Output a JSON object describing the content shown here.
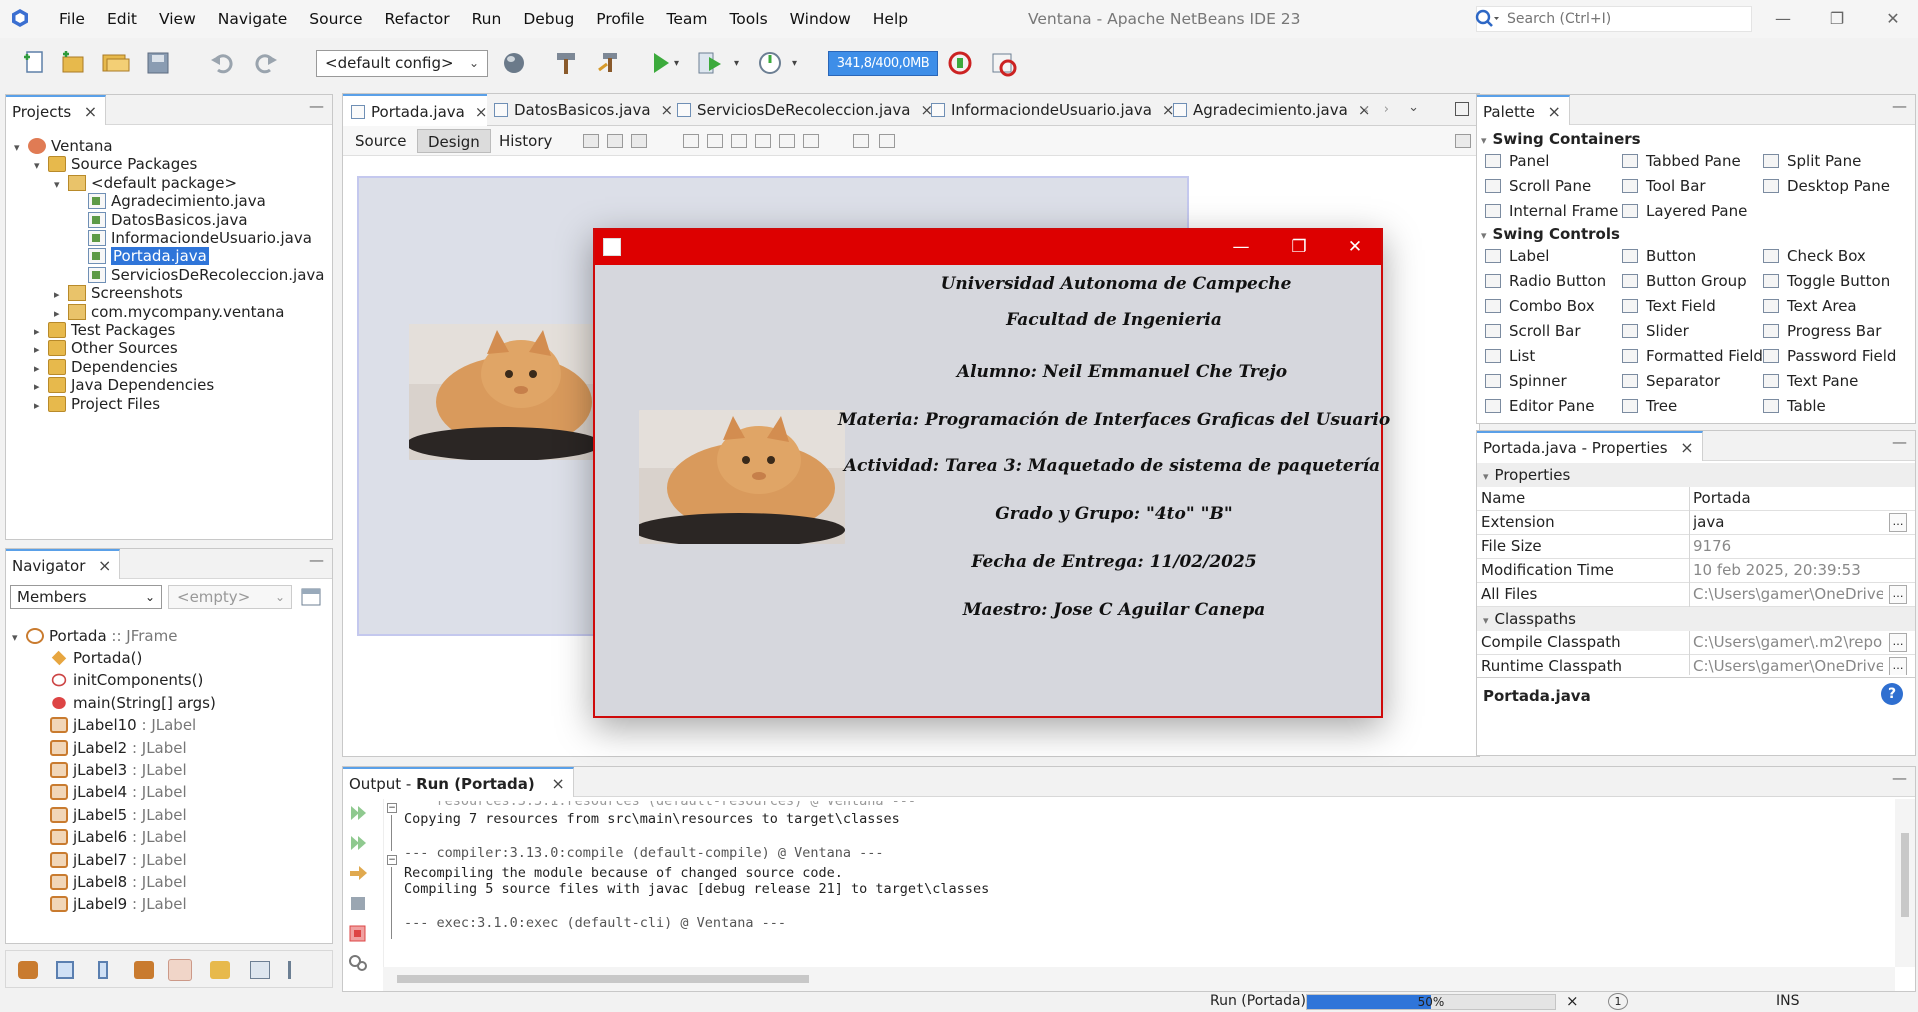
{
  "window": {
    "title": "Ventana - Apache NetBeans IDE 23",
    "search_placeholder": "Search (Ctrl+I)",
    "minimize": "—",
    "maximize": "❐",
    "close": "✕"
  },
  "menu": [
    "File",
    "Edit",
    "View",
    "Navigate",
    "Source",
    "Refactor",
    "Run",
    "Debug",
    "Profile",
    "Team",
    "Tools",
    "Window",
    "Help"
  ],
  "toolbar": {
    "config": "<default config>",
    "memory": "341,8/400,0MB",
    "memory_fraction": 0.854
  },
  "projects": {
    "tab": "Projects",
    "tree": [
      {
        "label": "Ventana",
        "icon": "project-icon",
        "depth": 0,
        "arrow": "▾"
      },
      {
        "label": "Source Packages",
        "icon": "folder-icon",
        "depth": 1,
        "arrow": "▾"
      },
      {
        "label": "<default package>",
        "icon": "package-icon",
        "depth": 2,
        "arrow": "▾"
      },
      {
        "label": "Agradecimiento.java",
        "icon": "java-file-icon",
        "depth": 3,
        "arrow": ""
      },
      {
        "label": "DatosBasicos.java",
        "icon": "java-file-icon",
        "depth": 3,
        "arrow": ""
      },
      {
        "label": "InformaciondeUsuario.java",
        "icon": "java-file-icon",
        "depth": 3,
        "arrow": ""
      },
      {
        "label": "Portada.java",
        "icon": "java-file-icon",
        "depth": 3,
        "arrow": "",
        "selected": true
      },
      {
        "label": "ServiciosDeRecoleccion.java",
        "icon": "java-file-icon",
        "depth": 3,
        "arrow": ""
      },
      {
        "label": "Screenshots",
        "icon": "package-icon",
        "depth": 2,
        "arrow": "▸"
      },
      {
        "label": "com.mycompany.ventana",
        "icon": "package-icon",
        "depth": 2,
        "arrow": "▸"
      },
      {
        "label": "Test Packages",
        "icon": "folder-icon",
        "depth": 1,
        "arrow": "▸"
      },
      {
        "label": "Other Sources",
        "icon": "folder-icon",
        "depth": 1,
        "arrow": "▸"
      },
      {
        "label": "Dependencies",
        "icon": "folder-icon",
        "depth": 1,
        "arrow": "▸"
      },
      {
        "label": "Java Dependencies",
        "icon": "folder-icon",
        "depth": 1,
        "arrow": "▸"
      },
      {
        "label": "Project Files",
        "icon": "folder-icon",
        "depth": 1,
        "arrow": "▸"
      }
    ]
  },
  "navigator": {
    "tab": "Navigator",
    "filter": "Members",
    "filter2": "<empty>",
    "root": {
      "name": "Portada",
      "type": " :: JFrame"
    },
    "members": [
      {
        "name": "Portada()",
        "type": "",
        "icon": "constructor-icon"
      },
      {
        "name": "initComponents()",
        "type": "",
        "icon": "method-icon"
      },
      {
        "name": "main(String[] args)",
        "type": "",
        "icon": "static-method-icon"
      },
      {
        "name": "jLabel10",
        "type": " : JLabel",
        "icon": "field-icon"
      },
      {
        "name": "jLabel2",
        "type": " : JLabel",
        "icon": "field-icon"
      },
      {
        "name": "jLabel3",
        "type": " : JLabel",
        "icon": "field-icon"
      },
      {
        "name": "jLabel4",
        "type": " : JLabel",
        "icon": "field-icon"
      },
      {
        "name": "jLabel5",
        "type": " : JLabel",
        "icon": "field-icon"
      },
      {
        "name": "jLabel6",
        "type": " : JLabel",
        "icon": "field-icon"
      },
      {
        "name": "jLabel7",
        "type": " : JLabel",
        "icon": "field-icon"
      },
      {
        "name": "jLabel8",
        "type": " : JLabel",
        "icon": "field-icon"
      },
      {
        "name": "jLabel9",
        "type": " : JLabel",
        "icon": "field-icon"
      }
    ]
  },
  "editor": {
    "tabs": [
      "Portada.java",
      "DatosBasicos.java",
      "ServiciosDeRecoleccion.java",
      "InformaciondeUsuario.java",
      "Agradecimiento.java"
    ],
    "active_tab": 0,
    "views": {
      "source": "Source",
      "design": "Design",
      "history": "History"
    }
  },
  "run_window": {
    "lines": [
      "Universidad Autonoma de Campeche",
      "Facultad de Ingenieria",
      "Alumno: Neil Emmanuel Che Trejo",
      "Materia: Programación de Interfaces Graficas del Usuario",
      "Actividad: Tarea 3: Maquetado de sistema de paquetería",
      "Grado y Grupo: \"4to\" \"B\"",
      "Fecha de Entrega: 11/02/2025",
      "Maestro: Jose C Aguilar Canepa"
    ]
  },
  "palette": {
    "tab": "Palette",
    "containers_title": "Swing Containers",
    "containers": [
      "Panel",
      "Tabbed Pane",
      "Split Pane",
      "Scroll Pane",
      "Tool Bar",
      "Desktop Pane",
      "Internal Frame",
      "Layered Pane"
    ],
    "controls_title": "Swing Controls",
    "controls": [
      "Label",
      "Button",
      "Check Box",
      "Radio Button",
      "Button Group",
      "Toggle Button",
      "Combo Box",
      "Text Field",
      "Text Area",
      "Scroll Bar",
      "Slider",
      "Progress Bar",
      "List",
      "Formatted Field",
      "Password Field",
      "Spinner",
      "Separator",
      "Text Pane",
      "Editor Pane",
      "Tree",
      "Table"
    ]
  },
  "properties": {
    "tab": "Portada.java - Properties",
    "section1": "Properties",
    "rows": [
      {
        "k": "Name",
        "v": "Portada",
        "dim": false,
        "dots": false
      },
      {
        "k": "Extension",
        "v": "java",
        "dim": false,
        "dots": true
      },
      {
        "k": "File Size",
        "v": "9176",
        "dim": true,
        "dots": false
      },
      {
        "k": "Modification Time",
        "v": "10 feb 2025, 20:39:53",
        "dim": true,
        "dots": false
      },
      {
        "k": "All Files",
        "v": "C:\\Users\\gamer\\OneDrive\\...",
        "dim": true,
        "dots": true
      }
    ],
    "section2": "Classpaths",
    "rows2": [
      {
        "k": "Compile Classpath",
        "v": "C:\\Users\\gamer\\.m2\\repos...",
        "dim": true,
        "dots": true
      },
      {
        "k": "Runtime Classpath",
        "v": "C:\\Users\\gamer\\OneDrive\\...",
        "dim": true,
        "dots": true
      }
    ],
    "footer": "Portada.java",
    "help": "?"
  },
  "output": {
    "tab_prefix": "Output - ",
    "tab_name": "Run (Portada)",
    "lines": [
      {
        "t": "    resources:3.3.1:resources (default-resources) @ Ventana ---",
        "grey": true
      },
      {
        "t": "Copying 7 resources from src\\main\\resources to target\\classes",
        "grey": false
      },
      {
        "t": "",
        "grey": false
      },
      {
        "t": "--- compiler:3.13.0:compile (default-compile) @ Ventana ---",
        "grey": true
      },
      {
        "t": "Recompiling the module because of changed source code.",
        "grey": false
      },
      {
        "t": "Compiling 5 source files with javac [debug release 21] to target\\classes",
        "grey": false
      },
      {
        "t": "",
        "grey": false
      },
      {
        "t": "--- exec:3.1.0:exec (default-cli) @ Ventana ---",
        "grey": true
      }
    ]
  },
  "status": {
    "task": "Run (Portada)",
    "progress": "50%",
    "progress_fraction": 0.5,
    "notifications": "1",
    "mode": "INS"
  }
}
